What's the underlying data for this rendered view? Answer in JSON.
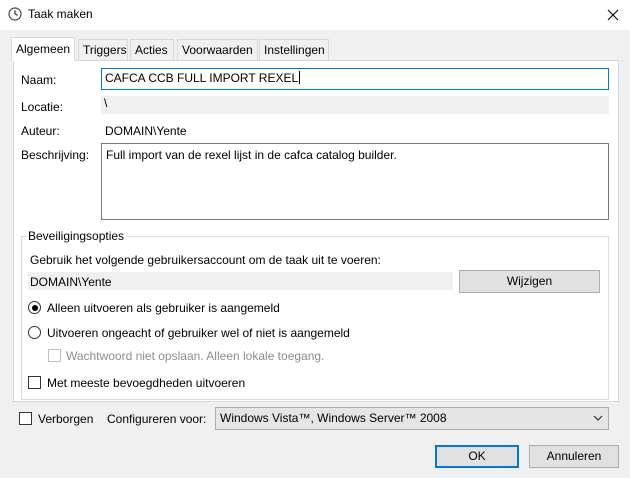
{
  "window": {
    "title": "Taak maken"
  },
  "tabs": [
    {
      "label": "Algemeen"
    },
    {
      "label": "Triggers"
    },
    {
      "label": "Acties"
    },
    {
      "label": "Voorwaarden"
    },
    {
      "label": "Instellingen"
    }
  ],
  "general": {
    "name_label": "Naam:",
    "name_value": "CAFCA CCB FULL IMPORT REXEL",
    "location_label": "Locatie:",
    "location_value": "\\",
    "author_label": "Auteur:",
    "author_value": "DOMAIN\\Yente",
    "description_label": "Beschrijving:",
    "description_value": "Full import van de rexel lijst in de cafca catalog builder."
  },
  "security": {
    "group_title": "Beveiligingsopties",
    "account_prompt": "Gebruik het volgende gebruikersaccount om de taak uit te voeren:",
    "account_value": "DOMAIN\\Yente",
    "change_button": "Wijzigen",
    "radio_logged_on": "Alleen uitvoeren als gebruiker is aangemeld",
    "radio_logged_on_checked": true,
    "radio_any": "Uitvoeren ongeacht of gebruiker wel of niet is aangemeld",
    "radio_any_checked": false,
    "no_store_password": "Wachtwoord niet opslaan. Alleen lokale toegang.",
    "highest_privileges": "Met meeste bevoegdheden uitvoeren"
  },
  "footer": {
    "hidden_label": "Verborgen",
    "configure_label": "Configureren voor:",
    "configure_value": "Windows Vista™, Windows Server™ 2008",
    "ok_button": "OK",
    "cancel_button": "Annuleren"
  }
}
